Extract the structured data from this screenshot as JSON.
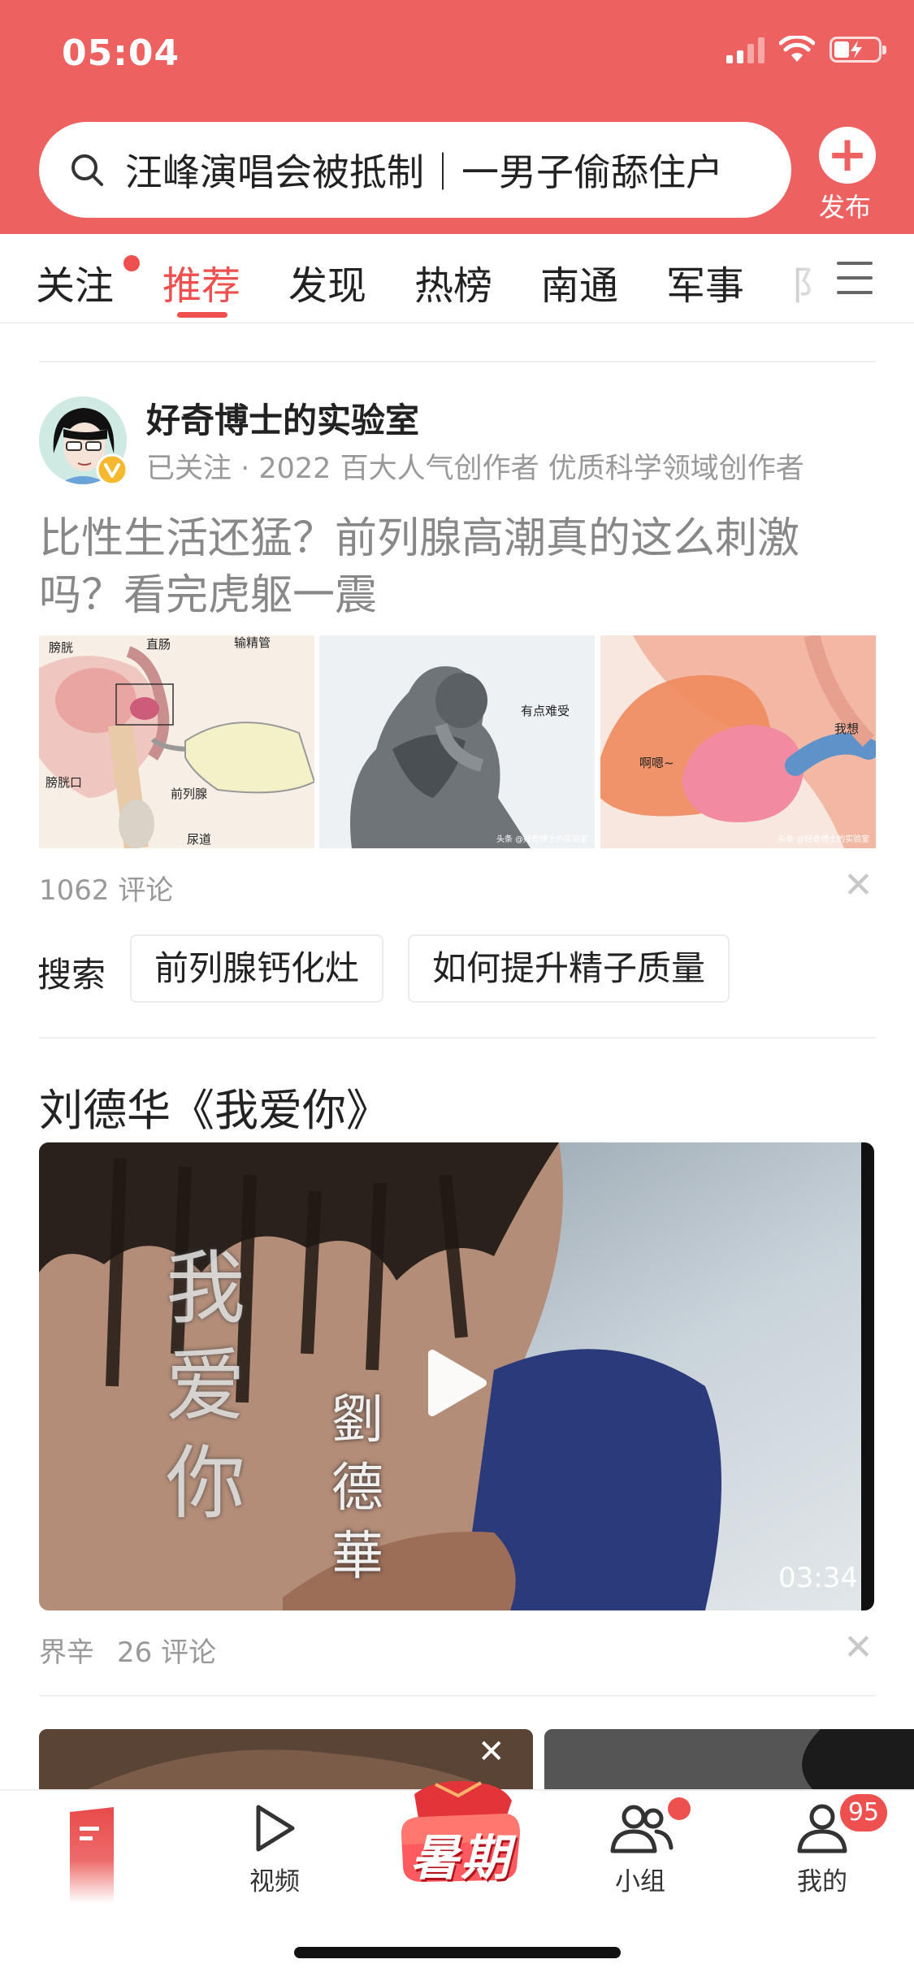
{
  "status_bar": {
    "time": "05:04"
  },
  "search": {
    "hint": "汪峰演唱会被抵制｜一男子偷舔住户"
  },
  "publish": {
    "label": "发布"
  },
  "tabs": [
    {
      "label": "关注",
      "active": false,
      "dot": true
    },
    {
      "label": "推荐",
      "active": true
    },
    {
      "label": "发现",
      "active": false
    },
    {
      "label": "热榜",
      "active": false
    },
    {
      "label": "南通",
      "active": false
    },
    {
      "label": "军事",
      "active": false
    },
    {
      "label": "阝",
      "active": false
    }
  ],
  "article": {
    "author": "好奇博士的实验室",
    "author_meta": "已关注 · 2022 百大人气创作者 优质科学领域创作者",
    "title": "比性生活还猛？前列腺高潮真的这么刺激吗？看完虎躯一震",
    "images": [
      {
        "labels": [
          "膀胱",
          "直肠",
          "输精管",
          "膀胱口",
          "前列腺",
          "尿道"
        ]
      },
      {
        "labels": [
          "有点难受",
          "头条 @好奇博士的实验室"
        ]
      },
      {
        "labels": [
          "我想",
          "啊嗯~",
          "头条 @好奇博士的实验室"
        ]
      }
    ],
    "comments": "1062 评论"
  },
  "related_search": {
    "label": "搜索",
    "chips": [
      "前列腺钙化灶",
      "如何提升精子质量"
    ]
  },
  "video": {
    "title": "刘德华《我爱你》",
    "overlay_title": "我爱你",
    "overlay_singer": "劉德華",
    "duration": "03:34",
    "source": "界辛",
    "comments": "26 评论"
  },
  "bottom_nav": {
    "video_label": "视频",
    "promo_label": "暑期",
    "group_label": "小组",
    "me_label": "我的",
    "me_badge": "95"
  },
  "colors": {
    "brand_red": "#ee6161",
    "active_tab": "#ee4f4f",
    "gray_text": "#999999"
  }
}
